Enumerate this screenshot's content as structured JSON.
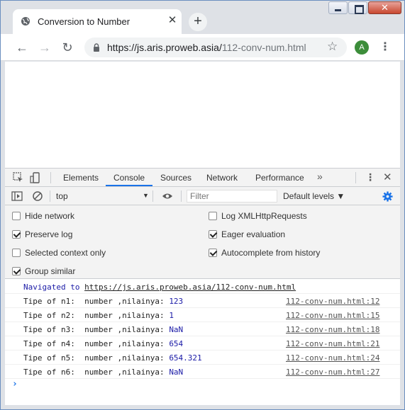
{
  "window": {
    "tab_title": "Conversion to Number",
    "tab_close": "✕",
    "new_tab": "+",
    "controls": {
      "close": "✕"
    }
  },
  "toolbar": {
    "back": "←",
    "forward": "→",
    "reload": "↻",
    "url_host": "https://js.aris.proweb.asia/",
    "url_path": "112-conv-num.html",
    "bookmark": "☆",
    "avatar_initial": "A",
    "menu": "⋮"
  },
  "devtools": {
    "tabs": [
      "Elements",
      "Console",
      "Sources",
      "Network",
      "Performance"
    ],
    "active_tab": "Console",
    "more": "»",
    "menu": "⋮",
    "close": "✕",
    "accent": "#1a73e8",
    "console_bar": {
      "context": "top",
      "context_arrow": "▼",
      "filter_placeholder": "Filter",
      "levels": "Default levels ▼"
    },
    "settings": [
      {
        "label": "Hide network",
        "checked": false
      },
      {
        "label": "Log XMLHttpRequests",
        "checked": false
      },
      {
        "label": "Preserve log",
        "checked": true
      },
      {
        "label": "Eager evaluation",
        "checked": true
      },
      {
        "label": "Selected context only",
        "checked": false
      },
      {
        "label": "Autocomplete from history",
        "checked": true
      },
      {
        "label": "Group similar",
        "checked": true
      }
    ],
    "console": {
      "navigated_prefix": "Navigated to ",
      "navigated_url": "https://js.aris.proweb.asia/112-conv-num.html",
      "messages": [
        {
          "prefix": "Tipe of n1:  number ,nilainya: ",
          "value": "123",
          "source": "112-conv-num.html:12"
        },
        {
          "prefix": "Tipe of n2:  number ,nilainya: ",
          "value": "1",
          "source": "112-conv-num.html:15"
        },
        {
          "prefix": "Tipe of n3:  number ,nilainya: ",
          "value": "NaN",
          "source": "112-conv-num.html:18"
        },
        {
          "prefix": "Tipe of n4:  number ,nilainya: ",
          "value": "654",
          "source": "112-conv-num.html:21"
        },
        {
          "prefix": "Tipe of n5:  number ,nilainya: ",
          "value": "654.321",
          "source": "112-conv-num.html:24"
        },
        {
          "prefix": "Tipe of n6:  number ,nilainya: ",
          "value": "NaN",
          "source": "112-conv-num.html:27"
        }
      ],
      "prompt": "›"
    }
  }
}
